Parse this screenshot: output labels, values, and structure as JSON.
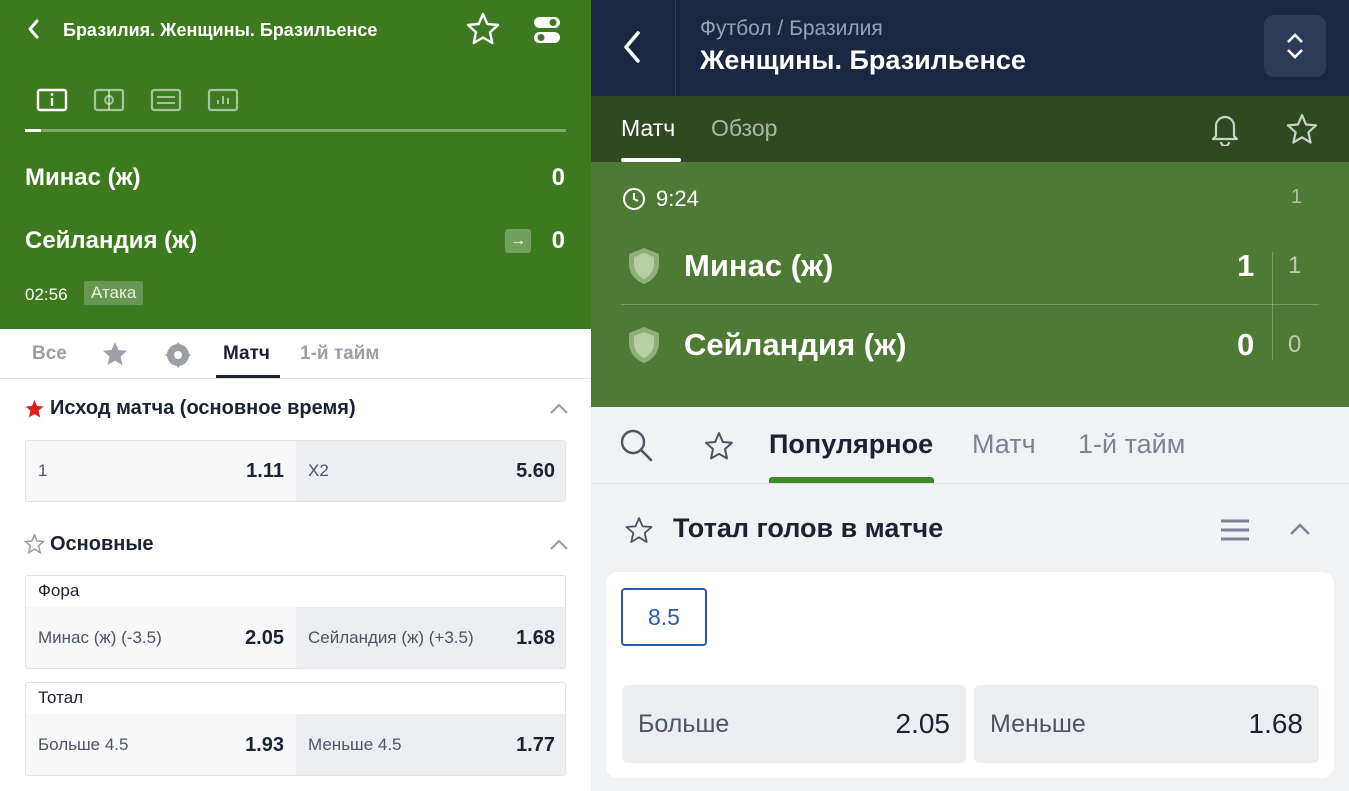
{
  "left": {
    "header": {
      "title": "Бразилия. Женщины. Бразильенсе",
      "progress": 0.03
    },
    "match": {
      "team1": "Минас (ж)",
      "score1": "0",
      "team2": "Сейландия (ж)",
      "score2": "0",
      "time": "02:56",
      "status": "Атака"
    },
    "tabs": [
      "Все",
      "Матч",
      "1-й тайм"
    ],
    "outcome": {
      "title": "Исход матча (основное время)",
      "cells": [
        {
          "name": "1",
          "odds": "1.11"
        },
        {
          "name": "X2",
          "odds": "5.60"
        }
      ]
    },
    "main": {
      "title": "Основные",
      "handicap": {
        "label": "Фора",
        "cells": [
          {
            "name": "Минас (ж) (-3.5)",
            "odds": "2.05"
          },
          {
            "name": "Сейландия (ж) (+3.5)",
            "odds": "1.68"
          }
        ]
      },
      "total": {
        "label": "Тотал",
        "cells": [
          {
            "name": "Больше 4.5",
            "odds": "1.93"
          },
          {
            "name": "Меньше 4.5",
            "odds": "1.77"
          }
        ]
      }
    }
  },
  "right": {
    "header": {
      "breadcrumb": "Футбол / Бразилия",
      "title": "Женщины. Бразильенсе"
    },
    "nav_tabs": [
      "Матч",
      "Обзор"
    ],
    "score": {
      "time": "9:24",
      "period": "1",
      "team1": "Минас (ж)",
      "score1": "1",
      "period_score1": "1",
      "team2": "Сейландия (ж)",
      "score2": "0",
      "period_score2": "0"
    },
    "filter_tabs": [
      "Популярное",
      "Матч",
      "1-й тайм"
    ],
    "market": {
      "title": "Тотал голов в матче",
      "line": "8.5",
      "over": {
        "name": "Больше",
        "odds": "2.05"
      },
      "under": {
        "name": "Меньше",
        "odds": "1.68"
      }
    }
  },
  "colors": {
    "left_header_green": "#3d7a1f",
    "right_header_navy": "#1a2740",
    "right_score_green": "#4f7a35",
    "active_underline_green": "#3f8a2c",
    "fav_star_red": "#e02020",
    "line_blue": "#2d5aa8"
  }
}
